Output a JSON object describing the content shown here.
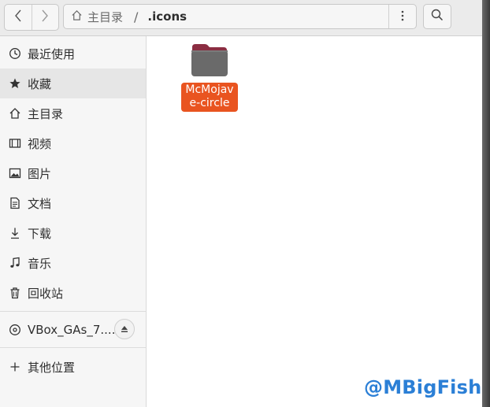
{
  "header": {
    "back_icon": "chevron-left-icon",
    "forward_icon": "chevron-right-icon",
    "path": {
      "home_label": "主目录",
      "separator": "/",
      "current": ".icons"
    },
    "menu_icon": "vertical-dots-icon",
    "search_icon": "search-icon"
  },
  "sidebar": {
    "items": [
      {
        "label": "最近使用",
        "icon": "clock-icon"
      },
      {
        "label": "收藏",
        "icon": "star-icon"
      },
      {
        "label": "主目录",
        "icon": "home-icon"
      },
      {
        "label": "视频",
        "icon": "film-icon"
      },
      {
        "label": "图片",
        "icon": "image-icon"
      },
      {
        "label": "文档",
        "icon": "document-icon"
      },
      {
        "label": "下载",
        "icon": "download-icon"
      },
      {
        "label": "音乐",
        "icon": "music-icon"
      },
      {
        "label": "回收站",
        "icon": "trash-icon"
      }
    ],
    "device": {
      "label": "VBox_GAs_7....",
      "icon": "disc-icon",
      "eject_icon": "eject-icon"
    },
    "other": {
      "label": "其他位置",
      "icon": "plus-icon"
    }
  },
  "content": {
    "items": [
      {
        "name": "McMojave-circle",
        "icon": "folder-icon",
        "selected": true
      }
    ]
  },
  "watermark": "@MBigFish",
  "colors": {
    "accent": "#e95420",
    "folder_body": "#6a6a6a",
    "folder_tab": "#8b2d42",
    "watermark": "#2b7fd6"
  }
}
